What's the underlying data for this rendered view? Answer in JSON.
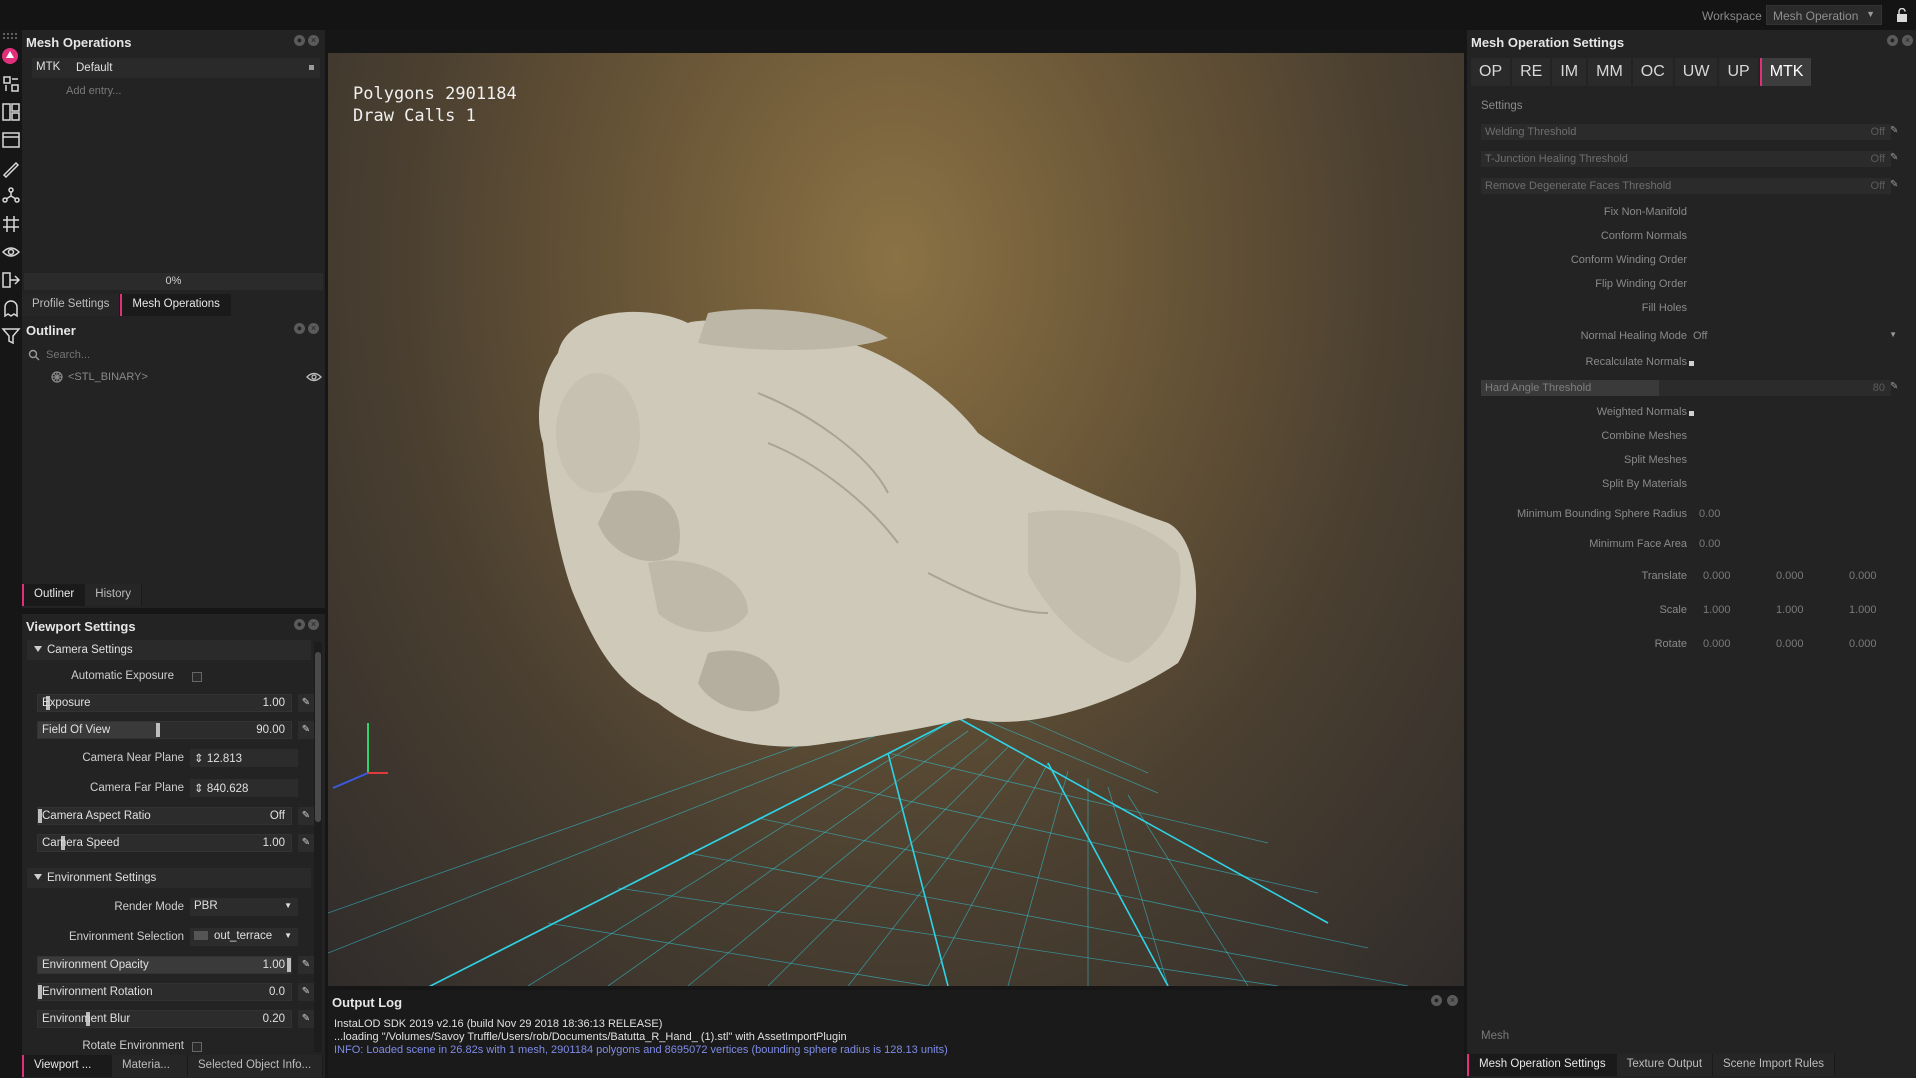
{
  "topbar": {
    "workspace_label": "Workspace",
    "workspace_value": "Mesh Operation"
  },
  "mesh_operations": {
    "title": "Mesh Operations",
    "entry_key": "MTK",
    "entry_value": "Default",
    "add_entry": "Add entry...",
    "progress": "0%",
    "tabs": [
      {
        "label": "Profile Settings"
      },
      {
        "label": "Mesh Operations"
      }
    ]
  },
  "outliner": {
    "title": "Outliner",
    "search_placeholder": "Search...",
    "item": "<STL_BINARY>",
    "tabs": [
      {
        "label": "Outliner"
      },
      {
        "label": "History"
      }
    ]
  },
  "viewport_settings": {
    "title": "Viewport Settings",
    "camera_section": "Camera Settings",
    "automatic_exposure": "Automatic Exposure",
    "exposure": {
      "label": "Exposure",
      "value": "1.00"
    },
    "fov": {
      "label": "Field Of View",
      "value": "90.00"
    },
    "near_plane": {
      "label": "Camera Near Plane",
      "value": "12.813"
    },
    "far_plane": {
      "label": "Camera Far Plane",
      "value": "840.628"
    },
    "aspect_ratio": {
      "label": "Camera Aspect Ratio",
      "value": "Off"
    },
    "camera_speed": {
      "label": "Camera Speed",
      "value": "1.00"
    },
    "environment_section": "Environment Settings",
    "render_mode": {
      "label": "Render Mode",
      "value": "PBR"
    },
    "env_selection": {
      "label": "Environment Selection",
      "value": "out_terrace"
    },
    "env_opacity": {
      "label": "Environment Opacity",
      "value": "1.00"
    },
    "env_rotation": {
      "label": "Environment Rotation",
      "value": "0.0"
    },
    "env_blur": {
      "label": "Environment Blur",
      "value": "0.20"
    },
    "rotate_env": "Rotate Environment",
    "tabs": [
      {
        "label": "Viewport ..."
      },
      {
        "label": "Materia..."
      },
      {
        "label": "Selected Object Info..."
      }
    ]
  },
  "viewport": {
    "polygons": "Polygons 2901184",
    "draw_calls": "Draw Calls 1"
  },
  "output_log": {
    "title": "Output Log",
    "lines": [
      "InstaLOD SDK 2019 v2.16 (build Nov 29 2018 18:36:13 RELEASE)",
      "...loading \"/Volumes/Savoy Truffle/Users/rob/Documents/Batutta_R_Hand_ (1).stl\" with AssetImportPlugin",
      "INFO: Loaded scene in 26.82s with 1 mesh, 2901184 polygons and 8695072 vertices (bounding sphere radius is 128.13 units)"
    ]
  },
  "mesh_op_settings": {
    "title": "Mesh Operation Settings",
    "tabs": [
      "OP",
      "RE",
      "IM",
      "MM",
      "OC",
      "UW",
      "UP",
      "MTK"
    ],
    "settings_header": "Settings",
    "welding": {
      "label": "Welding Threshold",
      "value": "Off"
    },
    "tjunction": {
      "label": "T-Junction Healing Threshold",
      "value": "Off"
    },
    "degenerate": {
      "label": "Remove Degenerate Faces Threshold",
      "value": "Off"
    },
    "fix_non_manifold": "Fix Non-Manifold",
    "conform_normals": "Conform Normals",
    "conform_winding": "Conform Winding Order",
    "flip_winding": "Flip Winding Order",
    "fill_holes": "Fill Holes",
    "normal_healing": {
      "label": "Normal Healing Mode",
      "value": "Off"
    },
    "recalculate_normals": "Recalculate Normals",
    "hard_angle": {
      "label": "Hard Angle Threshold",
      "value": "80"
    },
    "weighted_normals": "Weighted Normals",
    "combine_meshes": "Combine Meshes",
    "split_meshes": "Split Meshes",
    "split_materials": "Split By Materials",
    "min_bsphere": {
      "label": "Minimum Bounding Sphere Radius",
      "value": "0.00"
    },
    "min_face_area": {
      "label": "Minimum Face Area",
      "value": "0.00"
    },
    "translate": {
      "label": "Translate",
      "x": "0.000",
      "y": "0.000",
      "z": "0.000"
    },
    "scale": {
      "label": "Scale",
      "x": "1.000",
      "y": "1.000",
      "z": "1.000"
    },
    "rotate": {
      "label": "Rotate",
      "x": "0.000",
      "y": "0.000",
      "z": "0.000"
    },
    "mesh_label": "Mesh",
    "bottom_tabs": [
      {
        "label": "Mesh Operation Settings"
      },
      {
        "label": "Texture Output"
      },
      {
        "label": "Scene Import Rules"
      }
    ]
  },
  "colors": {
    "accent": "#e0307a",
    "grid": "#2fd3e6"
  }
}
